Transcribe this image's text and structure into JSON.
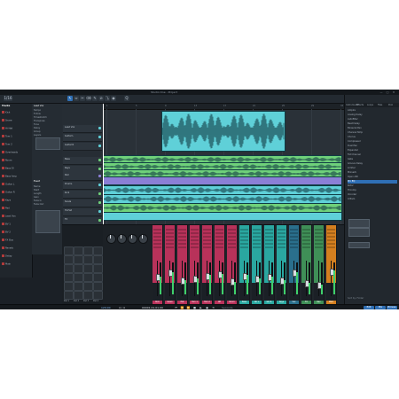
{
  "window": {
    "title": "Studio One - Project",
    "controls": [
      "—",
      "□",
      "✕"
    ]
  },
  "toolbar": {
    "buttons": [
      {
        "icon": "arrow-icon",
        "glyph": "↖"
      },
      {
        "icon": "range-icon",
        "glyph": "⇔"
      },
      {
        "icon": "split-icon",
        "glyph": "✂"
      },
      {
        "icon": "eraser-icon",
        "glyph": "⌫"
      },
      {
        "icon": "paint-icon",
        "glyph": "✎"
      },
      {
        "icon": "mute-icon",
        "glyph": "⊘"
      },
      {
        "icon": "bend-icon",
        "glyph": "⤵"
      },
      {
        "icon": "listen-icon",
        "glyph": "◉"
      }
    ],
    "snap_label": "1/16",
    "zoom_label": "Q"
  },
  "browser": {
    "tabs": [
      "Instruments",
      "Effects",
      "Loops",
      "Files",
      "Pool"
    ],
    "rows": [
      "Ampire",
      "Analog Delay",
      "Autofilter",
      "Beat Delay",
      "Binaural Pan",
      "Channel Strip",
      "Chorus",
      "Compressor",
      "Dual Pan",
      "Expander",
      "Fat Channel",
      "Gate",
      "Groove Delay",
      "Limiter",
      "Mixverb",
      "Open AIR",
      "Pro EQ",
      "Rotor",
      "Tricomp",
      "Vocoder",
      "X-Trem"
    ],
    "selected_index": 16,
    "footer": "Sort by: Folder"
  },
  "left_panel": {
    "header": "Tracks",
    "items": [
      "Kick",
      "Snare",
      "Hi-Hat",
      "Tom 1",
      "Tom 2",
      "Overheads",
      "Room",
      "Bass DI",
      "Bass Amp",
      "Guitar L",
      "Guitar R",
      "Keys",
      "Pad",
      "Lead Vox",
      "BV 1",
      "BV 2",
      "FX Bus",
      "Reverb",
      "Delay",
      "Main"
    ]
  },
  "inspector": {
    "title": "Lead Vox",
    "rows": [
      "Tempo",
      "Follow",
      "Timestretch",
      "Transpose",
      "Tune",
      "Delay",
      "Group",
      "Layers"
    ],
    "section2": "Event",
    "rows2": [
      "Name",
      "Start",
      "Length",
      "Gain",
      "Fade In",
      "Fade Out"
    ]
  },
  "tracks": [
    {
      "name": "Lead Vox",
      "color": "#5fd0d8"
    },
    {
      "name": "Guitar L",
      "color": "#5fd0d8"
    },
    {
      "name": "Guitar R",
      "color": "#5fd0d8"
    },
    {
      "name": "Bass",
      "color": "#6fd17a"
    },
    {
      "name": "Keys",
      "color": "#6fd17a"
    },
    {
      "name": "Pad",
      "color": "#8b7fd6"
    },
    {
      "name": "Drums",
      "color": "#5fd0d8"
    },
    {
      "name": "Kick",
      "color": "#6fd17a"
    },
    {
      "name": "Snare",
      "color": "#6fd17a"
    },
    {
      "name": "Hi-Hat",
      "color": "#5fd0d8"
    },
    {
      "name": "FX",
      "color": "#6fd17a"
    },
    {
      "name": "Reverb",
      "color": "#5fd0d8"
    }
  ],
  "ruler_ticks": [
    "1",
    "5",
    "9",
    "13",
    "17",
    "21",
    "25",
    "29",
    "33"
  ],
  "mixer": {
    "channels": [
      {
        "name": "Kick",
        "color": "#b8325a",
        "level": 0.55
      },
      {
        "name": "Snare",
        "color": "#b8325a",
        "level": 0.7
      },
      {
        "name": "Hat",
        "color": "#b8325a",
        "level": 0.45
      },
      {
        "name": "Tom 1",
        "color": "#b8325a",
        "level": 0.5
      },
      {
        "name": "Tom 2",
        "color": "#b8325a",
        "level": 0.6
      },
      {
        "name": "OH",
        "color": "#b8325a",
        "level": 0.65
      },
      {
        "name": "Room",
        "color": "#b8325a",
        "level": 0.4
      },
      {
        "name": "Bass",
        "color": "#2aa7a0",
        "level": 0.6
      },
      {
        "name": "Gtr L",
        "color": "#2aa7a0",
        "level": 0.5
      },
      {
        "name": "Gtr R",
        "color": "#2aa7a0",
        "level": 0.55
      },
      {
        "name": "Keys",
        "color": "#2aa7a0",
        "level": 0.45
      },
      {
        "name": "Vox",
        "color": "#2a6f8c",
        "level": 0.7
      },
      {
        "name": "FX",
        "color": "#3f8f57",
        "level": 0.35
      },
      {
        "name": "Rev",
        "color": "#3f8f57",
        "level": 0.3
      },
      {
        "name": "Main",
        "color": "#d47f1f",
        "level": 0.75
      }
    ],
    "pad_labels": [
      "Pad 1",
      "Pad 2",
      "Pad 3",
      "Pad 4"
    ]
  },
  "transport": {
    "timecode": "00001.01.01.00",
    "tempo": "120.00",
    "signature": "4 / 4",
    "time_label": "Seconds",
    "buttons": [
      "⏮",
      "⏪",
      "⏩",
      "■",
      "▶",
      "●",
      "⟲"
    ],
    "right_pills": [
      "Edit",
      "Mix",
      "Browse"
    ]
  },
  "colors": {
    "accent": "#2f6fb5",
    "clip_teal": "#5fd0d8",
    "clip_green": "#6fd17a",
    "clip_purple": "#8b7fd6",
    "mixer_red": "#b8325a"
  }
}
